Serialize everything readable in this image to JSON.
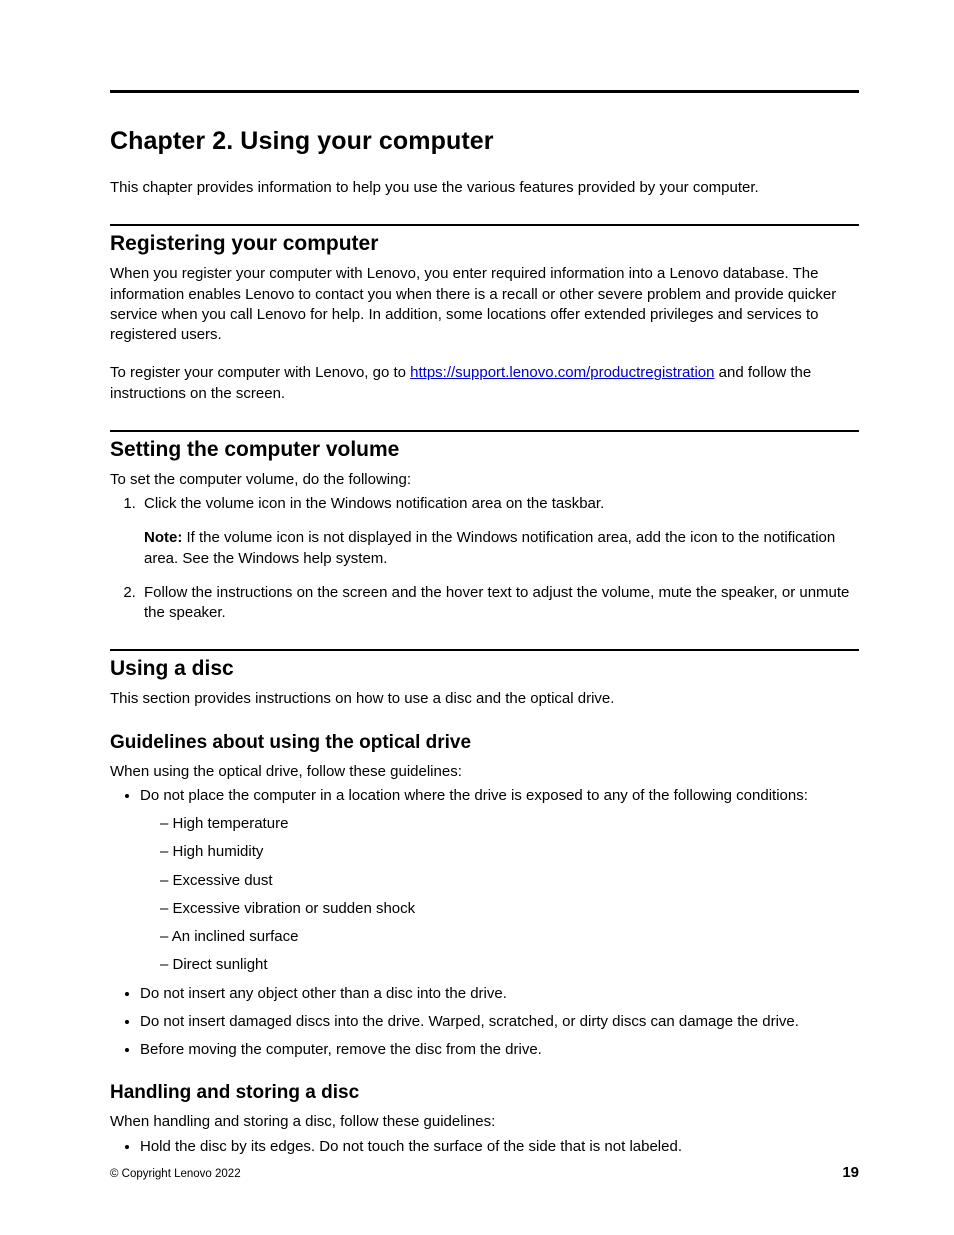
{
  "chapter": {
    "title": "Chapter 2.   Using your computer",
    "intro": "This chapter provides information to help you use the various features provided by your computer."
  },
  "sections": {
    "register": {
      "heading": "Registering your computer",
      "p1": "When you register your computer with Lenovo, you enter required information into a Lenovo database. The information enables Lenovo to contact you when there is a recall or other severe problem and provide quicker service when you call Lenovo for help. In addition, some locations offer extended privileges and services to registered users.",
      "p2_pre": "To register your computer with Lenovo, go to ",
      "p2_link_text": "https://support.lenovo.com/productregistration",
      "p2_link_href": "https://support.lenovo.com/productregistration",
      "p2_post": " and follow the instructions on the screen."
    },
    "volume": {
      "heading": "Setting the computer volume",
      "intro": "To set the computer volume, do the following:",
      "step1": "Click the volume icon in the Windows notification area on the taskbar.",
      "note_label": "Note:  ",
      "note_body": "If the volume icon is not displayed in the Windows notification area, add the icon to the notification area. See the Windows help system.",
      "step2": "Follow the instructions on the screen and the hover text to adjust the volume, mute the speaker, or unmute the speaker."
    },
    "disc": {
      "heading": "Using a disc",
      "intro": "This section provides instructions on how to use a disc and the optical drive.",
      "guidelines_h": "Guidelines about using the optical drive",
      "guidelines_intro": "When using the optical drive, follow these guidelines:",
      "b1": "Do not place the computer in a location where the drive is exposed to any of the following conditions:",
      "conditions": [
        "High temperature",
        "High humidity",
        "Excessive dust",
        "Excessive vibration or sudden shock",
        "An inclined surface",
        "Direct sunlight"
      ],
      "b2": "Do not insert any object other than a disc into the drive.",
      "b3": "Do not insert damaged discs into the drive. Warped, scratched, or dirty discs can damage the drive.",
      "b4": "Before moving the computer, remove the disc from the drive.",
      "handling_h": "Handling and storing a disc",
      "handling_intro": "When handling and storing a disc, follow these guidelines:",
      "h1": "Hold the disc by its edges. Do not touch the surface of the side that is not labeled."
    }
  },
  "footer": {
    "copyright": "© Copyright Lenovo 2022",
    "page_number": "19"
  }
}
